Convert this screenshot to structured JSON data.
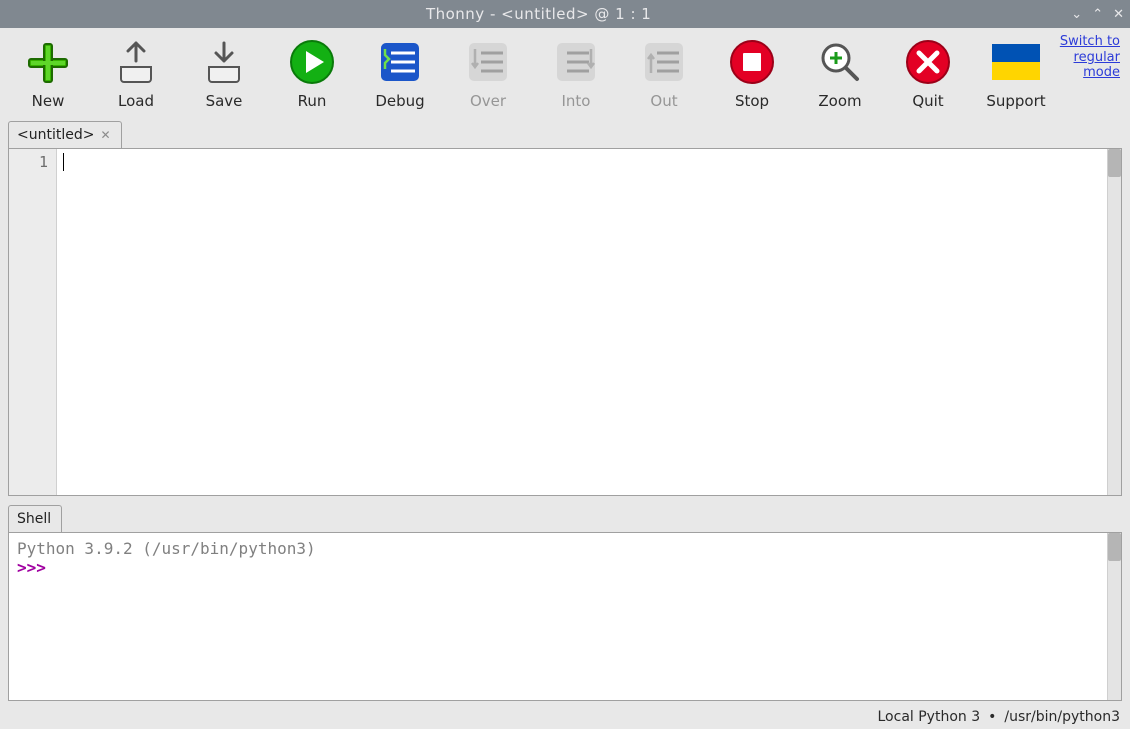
{
  "window": {
    "title": "Thonny  -  <untitled>  @  1 : 1"
  },
  "toolbar": {
    "items": [
      {
        "id": "new",
        "label": "New",
        "disabled": false
      },
      {
        "id": "load",
        "label": "Load",
        "disabled": false
      },
      {
        "id": "save",
        "label": "Save",
        "disabled": false
      },
      {
        "id": "run",
        "label": "Run",
        "disabled": false
      },
      {
        "id": "debug",
        "label": "Debug",
        "disabled": false
      },
      {
        "id": "over",
        "label": "Over",
        "disabled": true
      },
      {
        "id": "into",
        "label": "Into",
        "disabled": true
      },
      {
        "id": "out",
        "label": "Out",
        "disabled": true
      },
      {
        "id": "stop",
        "label": "Stop",
        "disabled": false
      },
      {
        "id": "zoom",
        "label": "Zoom",
        "disabled": false
      },
      {
        "id": "quit",
        "label": "Quit",
        "disabled": false
      },
      {
        "id": "support",
        "label": "Support",
        "disabled": false
      }
    ],
    "mode_link": "Switch to\nregular\nmode"
  },
  "editor": {
    "tab_name": "<untitled>",
    "line_numbers": [
      "1"
    ],
    "content": ""
  },
  "shell": {
    "tab_name": "Shell",
    "banner": "Python 3.9.2 (/usr/bin/python3)",
    "prompt": ">>> "
  },
  "statusbar": {
    "interpreter": "Local Python 3",
    "path": "/usr/bin/python3"
  }
}
